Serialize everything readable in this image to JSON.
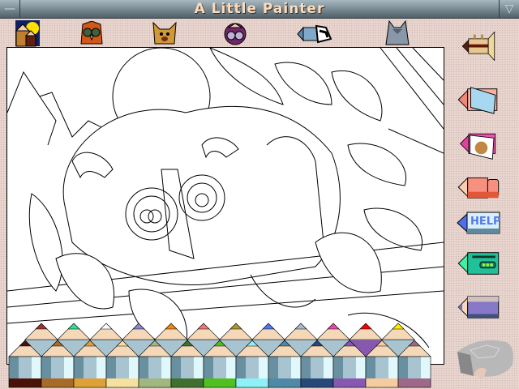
{
  "window": {
    "title": "A Little Painter",
    "menu_icon": "minus-icon",
    "collapse_icon": "triangle-down-icon"
  },
  "pictures": [
    {
      "name": "picture-house-icon"
    },
    {
      "name": "picture-owl-icon"
    },
    {
      "name": "picture-dog-icon"
    },
    {
      "name": "picture-lemur-icon"
    },
    {
      "name": "picture-shoe-icon"
    },
    {
      "name": "picture-cat-icon"
    }
  ],
  "tools": [
    {
      "name": "music-trumpet-button"
    },
    {
      "name": "new-page-button"
    },
    {
      "name": "fill-stamp-button"
    },
    {
      "name": "stop-hand-button"
    },
    {
      "name": "help-button",
      "label": "HELP"
    },
    {
      "name": "sound-player-button"
    },
    {
      "name": "current-color-pencil-button"
    },
    {
      "name": "sharpener-button"
    }
  ],
  "palette": {
    "back_row": [
      "#993333",
      "#33dd99",
      "#ffffff",
      "#8888cc",
      "#ee8811",
      "#ee7777",
      "#aa9933",
      "#5577ee",
      "#aabbcc",
      "#ee44aa",
      "#ff0000",
      "#ffee00"
    ],
    "front_row": [
      "#4a1208",
      "#a86a28",
      "#e0a038",
      "#f5e0a0",
      "#a0b880",
      "#407030",
      "#50c020",
      "#90f0f8",
      "#5088a8",
      "#284878",
      "#8858b0",
      "#f5cca0",
      "#a06888"
    ],
    "selected_back_index": 10
  }
}
